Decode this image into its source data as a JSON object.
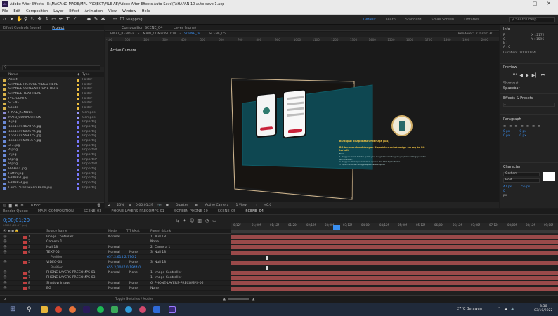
{
  "window": {
    "title": "Adobe After Effects - E:\\MAGANG MADE\\MPL PROJECT\\FILE AE\\Adobe After Effects Auto-Save\\TAHAPAN 10 auto-save 1.aep",
    "app_icon": "Ae",
    "menu": [
      "File",
      "Edit",
      "Composition",
      "Layer",
      "Effect",
      "Animation",
      "View",
      "Window",
      "Help"
    ]
  },
  "toolbar": {
    "tools": [
      "home-icon",
      "selection-icon",
      "hand-icon",
      "zoom-icon",
      "orbit-icon",
      "pan-icon",
      "dolly-icon",
      "rect-icon",
      "pen-icon",
      "text-icon",
      "brush-icon",
      "stamp-icon",
      "eraser-icon",
      "roto-icon",
      "pin-icon"
    ],
    "snapping_label": "Snapping",
    "workspaces": [
      "Default",
      "Learn",
      "Standard",
      "Small Screen",
      "Libraries"
    ],
    "active_workspace": "Default",
    "search_placeholder": "Search Help"
  },
  "left_panel": {
    "tabs": [
      "Effect Controls (none)",
      "Project"
    ],
    "active_tab": "Project",
    "search_icon": "search-icon",
    "columns": {
      "name": "Name",
      "type": "Type"
    },
    "items": [
      {
        "name": "Asset",
        "type": "Folder",
        "icon": "folder",
        "label_color": "#f0c040"
      },
      {
        "name": "CHANGE PICTURE VIDEO HERE",
        "type": "Folder",
        "icon": "folder",
        "label_color": "#f0c040"
      },
      {
        "name": "CHANGE SCREEN PHONE HERE",
        "type": "Folder",
        "icon": "folder",
        "label_color": "#f0c040"
      },
      {
        "name": "CHANGE TEXT HERE",
        "type": "Folder",
        "icon": "folder",
        "label_color": "#f0c040"
      },
      {
        "name": "PRE COMPS",
        "type": "Folder",
        "icon": "folder",
        "label_color": "#f0c040"
      },
      {
        "name": "SCENE",
        "type": "Folder",
        "icon": "folder",
        "label_color": "#f0c040"
      },
      {
        "name": "Solids",
        "type": "Folder",
        "icon": "folder",
        "label_color": "#f0c040"
      },
      {
        "name": "FINAL_RENDER",
        "type": "Compos",
        "icon": "comp",
        "label_color": "#9a9aff"
      },
      {
        "name": "MAIN_COMPOSITION",
        "type": "Compos",
        "icon": "comp",
        "label_color": "#9a9aff"
      },
      {
        "name": "1.jpg",
        "type": "ImporteJ",
        "icon": "image",
        "label_color": "#7a7aff"
      },
      {
        "name": "1661449467872.jpg",
        "type": "ImporteJ",
        "icon": "image",
        "label_color": "#7a7aff"
      },
      {
        "name": "1661449609570.jpg",
        "type": "ImporteJ",
        "icon": "image",
        "label_color": "#7a7aff"
      },
      {
        "name": "1661449569375.jpg",
        "type": "ImporteJ",
        "icon": "image",
        "label_color": "#7a7aff"
      },
      {
        "name": "1661449594157.jpg",
        "type": "ImporteJ",
        "icon": "image",
        "label_color": "#7a7aff"
      },
      {
        "name": "3-3.jpg",
        "type": "ImporteJ",
        "icon": "image",
        "label_color": "#7a7aff"
      },
      {
        "name": "4.png",
        "type": "ImporteP",
        "icon": "image",
        "label_color": "#7a7aff"
      },
      {
        "name": "7.jpg",
        "type": "ImporteJ",
        "icon": "image",
        "label_color": "#7a7aff"
      },
      {
        "name": "8.png",
        "type": "ImporteP",
        "icon": "image",
        "label_color": "#7a7aff"
      },
      {
        "name": "8.png",
        "type": "ImporteP",
        "icon": "image",
        "label_color": "#7a7aff"
      },
      {
        "name": "BPHH-1.jpg",
        "type": "ImporteJ",
        "icon": "image",
        "label_color": "#7a7aff"
      },
      {
        "name": "Fatfm.jpg",
        "type": "ImporteJ",
        "icon": "image",
        "label_color": "#7a7aff"
      },
      {
        "name": "FAPHR-1.jpg",
        "type": "ImporteJ",
        "icon": "image",
        "label_color": "#7a7aff"
      },
      {
        "name": "FAPHR-3.jpg",
        "type": "ImporteJ",
        "icon": "image",
        "label_color": "#7a7aff"
      },
      {
        "name": "Form Persetujuan Bank.jpg",
        "type": "ImporteJ",
        "icon": "image",
        "label_color": "#7a7aff"
      }
    ],
    "footer": "8 bpc"
  },
  "composition": {
    "tabs": [
      "Composition SCENE_04",
      "Layer (none)"
    ],
    "breadcrumb": [
      "FINAL_RENDER",
      "MAIN_COMPOSITION",
      "SCENE_04",
      "SCENE_05"
    ],
    "renderer": "Renderer:",
    "renderer_value": "Classic 3D",
    "view_label": "Active Camera",
    "ruler": [
      "-100",
      "100",
      "200",
      "300",
      "400",
      "500",
      "600",
      "700",
      "800",
      "900",
      "1000",
      "1100",
      "1200",
      "1300",
      "1400",
      "1500",
      "1600",
      "1700",
      "1800",
      "1900",
      "2000"
    ],
    "card": {
      "heading": "BO Input di Aplikasi Order Aja (OA)",
      "subheading": "BO berkoordinasi dengan Dispatcher untuk sedge survey ke BO terkait.",
      "note_title": "Note:",
      "notes": "1. Pengajuan sistem terbatas apabila yang mengajukan ke cabang lain yang bukan cabangnya sendiri akan ditangani.\n2. Pengajuan dimanapun tidak dapat diproses atau tidak dapat diterima.\n3. Digital nomor dan ditunggu kepada nasabah sp. BO"
    },
    "footer": {
      "zoom": "25%",
      "timecode": "0;00;01;29",
      "quality": "Quarter",
      "camera": "Active Camera",
      "view": "1 View",
      "exposure": "+0.0"
    }
  },
  "right_panel": {
    "info": {
      "title": "Info",
      "r": "R :",
      "g": "G :",
      "b": "B :",
      "a": "A : 0",
      "x": "X : 2172",
      "y": "Y : 1596",
      "duration": "Duration: 0;00;00;04"
    },
    "preview": {
      "title": "Preview"
    },
    "shortcut": {
      "title": "Shortcut",
      "value": "Spacebar"
    },
    "effects": {
      "title": "Effects & Presets"
    },
    "paragraph": {
      "title": "Paragraph",
      "values": [
        "0 px",
        "0 px",
        "0 px",
        "0 px",
        "0 px"
      ]
    },
    "character": {
      "title": "Character",
      "font": "Gotham",
      "style": "Bold",
      "size": "47 px",
      "leading": "55 px",
      "tracking": "0",
      "stroke": "px"
    }
  },
  "timeline": {
    "tabs": [
      "Render Queue",
      "MAIN_COMPOSITION",
      "SCENE_03",
      "PHONE LAYERS-PRECOMPS-01",
      "SCREEN-PHONE-10",
      "SCENE_05",
      "SCENE_04"
    ],
    "active_tab": "SCENE_04",
    "timecode": "0;00;01;29",
    "fps_note": "00059 (29.97 fps)",
    "headers": {
      "source": "Source Name",
      "mode": "Mode",
      "track": "T TrkMat",
      "parent": "Parent & Link"
    },
    "ruler": [
      "0;12f",
      "01;00f",
      "01;12f",
      "01;20f",
      "02;12f",
      "03;00f",
      "03;12f",
      "04;00f",
      "04;12f",
      "05;00f",
      "05;12f",
      "06;00f",
      "06;12f",
      "07;00f",
      "07;12f",
      "08;00f",
      "08;12f",
      "09;00f",
      "09;1"
    ],
    "layers": [
      {
        "num": "1",
        "name": "Image Controller",
        "mode": "Normal",
        "trk": "",
        "parent": "1. Null 18",
        "label_color": "#c04040",
        "sub": false
      },
      {
        "num": "2",
        "name": "Camera 1",
        "mode": "",
        "trk": "",
        "parent": "None",
        "label_color": "#c04040",
        "sub": false
      },
      {
        "num": "3",
        "name": "Null 18",
        "mode": "Normal",
        "trk": "",
        "parent": "2. Camera 1",
        "label_color": "#c04040",
        "sub": false
      },
      {
        "num": "4",
        "name": "TEXT-05",
        "mode": "Normal",
        "trk": "None",
        "parent": "3. Null 18",
        "label_color": "#c04040",
        "sub": false
      },
      {
        "num": "",
        "name": "Position",
        "mode": "",
        "trk": "",
        "parent": "",
        "value": "657.2,615.2,776.2",
        "label_color": "",
        "sub": true
      },
      {
        "num": "5",
        "name": "VIDEO-04",
        "mode": "Normal",
        "trk": "None",
        "parent": "3. Null 18",
        "label_color": "#c04040",
        "sub": false
      },
      {
        "num": "",
        "name": "Position",
        "mode": "",
        "trk": "",
        "parent": "",
        "value": "655.2,1007.0,1944.0",
        "label_color": "",
        "sub": true
      },
      {
        "num": "6",
        "name": "PHONE-LAYERS-PRECOMPS-01",
        "mode": "Normal",
        "trk": "None",
        "parent": "1. Image Controller",
        "label_color": "#c04040",
        "sub": false
      },
      {
        "num": "7",
        "name": "PHONE-LAYERS-PRECOMPS-03",
        "mode": "",
        "trk": "",
        "parent": "1. Image Controller",
        "label_color": "#c04040",
        "sub": false
      },
      {
        "num": "8",
        "name": "Shadow Image",
        "mode": "Normal",
        "trk": "None",
        "parent": "6. PHONE-LAYERS-PRECOMPS-06",
        "label_color": "#c04040",
        "sub": false
      },
      {
        "num": "9",
        "name": "BG",
        "mode": "Normal",
        "trk": "None",
        "parent": "None",
        "label_color": "#c04040",
        "sub": false
      }
    ],
    "footer": "Toggle Switches / Modes"
  },
  "taskbar": {
    "weather": "27°C Berawan",
    "time": "3:56",
    "date": "03/10/2022",
    "icons": [
      "windows-icon",
      "search-icon",
      "files-icon",
      "chrome-icon",
      "firefox-icon",
      "premiere-icon",
      "spotify-icon",
      "green-icon",
      "edge-icon",
      "aftereffects-icon",
      "store-icon",
      "ae2-icon"
    ]
  }
}
